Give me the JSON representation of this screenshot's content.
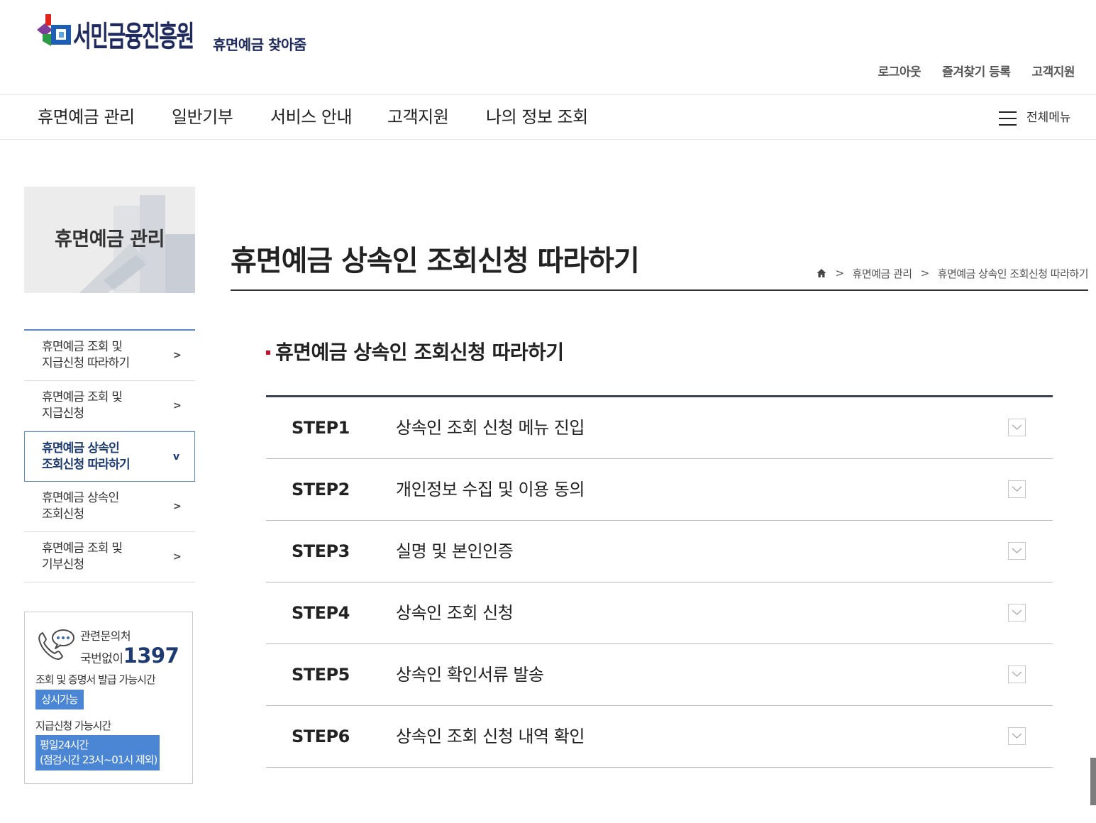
{
  "header": {
    "logo_text": "서민금융진흥원",
    "logo_icon": "logo-icon",
    "service_name": "휴면예금 찾아줌",
    "util_links": [
      "로그아웃",
      "즐겨찾기 등록",
      "고객지원"
    ]
  },
  "gnb": {
    "items": [
      "휴면예금 관리",
      "일반기부",
      "서비스 안내",
      "고객지원",
      "나의 정보 조회"
    ],
    "all_menu_icon": "hamburger-menu-icon",
    "all_menu_label": "전체메뉴"
  },
  "sidebar": {
    "title": "휴면예금 관리",
    "menu": [
      {
        "line1": "휴면예금 조회 및",
        "line2": "지급신청 따라하기",
        "arrow": ">",
        "active": false
      },
      {
        "line1": "휴면예금 조회 및",
        "line2": "지급신청",
        "arrow": ">",
        "active": false
      },
      {
        "line1": "휴면예금 상속인",
        "line2": "조회신청 따라하기",
        "arrow": "v",
        "active": true
      },
      {
        "line1": "휴면예금 상속인",
        "line2": "조회신청",
        "arrow": ">",
        "active": false
      },
      {
        "line1": "휴면예금 조회 및",
        "line2": "기부신청",
        "arrow": ">",
        "active": false
      }
    ],
    "contact": {
      "icon": "phone-chat-icon",
      "label": "관련문의처",
      "prefix": "국번없이",
      "number": "1397",
      "inquiry_hours_label": "조회 및 증명서 발급 가능시간",
      "inquiry_hours_badge": "상시가능",
      "payment_hours_label": "지급신청 가능시간",
      "payment_hours_line1": "평일24시간",
      "payment_hours_line2": "(점검시간 23시~01시 제외)"
    }
  },
  "main": {
    "page_title": "휴면예금 상속인 조회신청 따라하기",
    "breadcrumb": {
      "home_icon": "home-icon",
      "separator": ">",
      "items": [
        "휴면예금 관리",
        "휴면예금 상속인 조회신청 따라하기"
      ]
    },
    "section_title": "휴면예금 상속인 조회신청 따라하기",
    "toggle_icon": "chevron-down-icon",
    "steps": [
      {
        "step": "STEP1",
        "title": "상속인 조회 신청 메뉴 진입",
        "expanded": false
      },
      {
        "step": "STEP2",
        "title": "개인정보 수집 및 이용 동의",
        "expanded": false
      },
      {
        "step": "STEP3",
        "title": "실명 및 본인인증",
        "expanded": false
      },
      {
        "step": "STEP4",
        "title": "상속인 조회 신청",
        "expanded": false
      },
      {
        "step": "STEP5",
        "title": "상속인 확인서류 발송",
        "expanded": false
      },
      {
        "step": "STEP6",
        "title": "상속인 조회 신청 내역 확인",
        "expanded": false
      }
    ]
  },
  "colors": {
    "brand_navy": "#1f2b5e",
    "accent_blue": "#4a86d4",
    "active_border": "#5b88c6",
    "active_text": "#1d3b72",
    "bullet_red": "#c8102e",
    "text_dark": "#222222",
    "rule_dark": "#3a4150"
  }
}
